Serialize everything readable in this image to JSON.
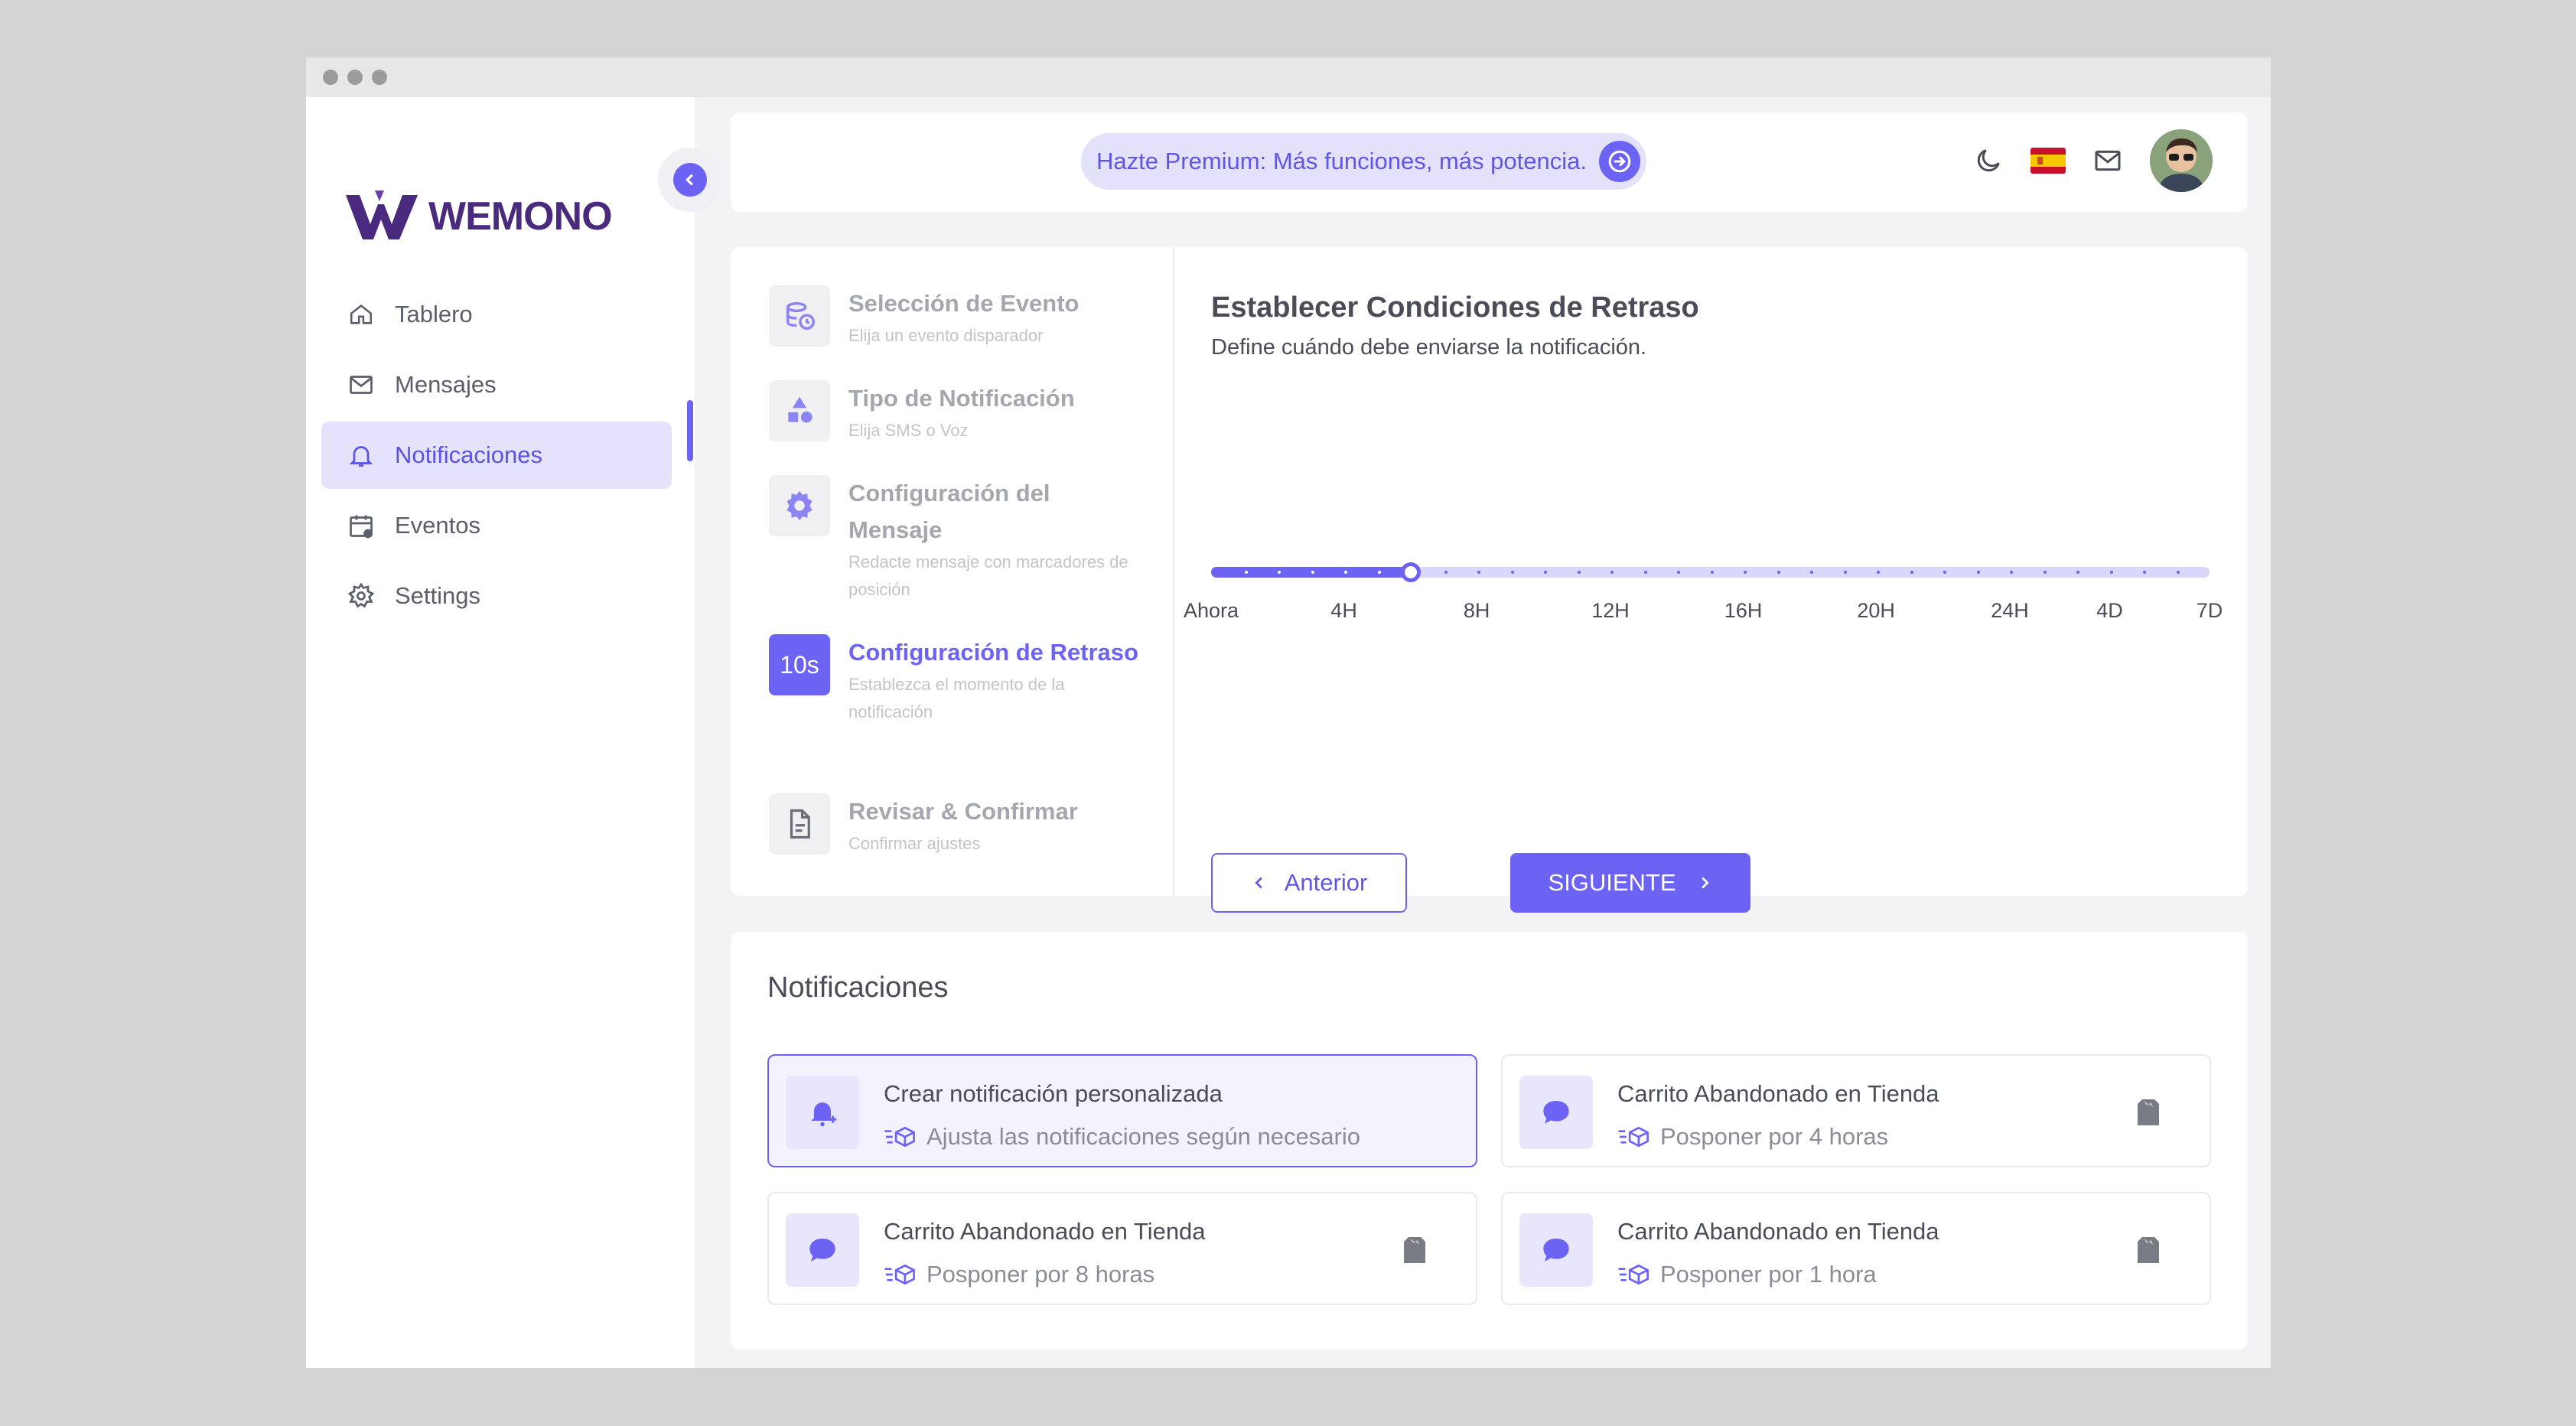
{
  "brand": {
    "name": "WEMONO",
    "accent": "#6c63f5",
    "logo_color": "#4a2a7e"
  },
  "sidebar": {
    "items": [
      {
        "label": "Tablero",
        "icon": "home-icon"
      },
      {
        "label": "Mensajes",
        "icon": "mail-icon"
      },
      {
        "label": "Notificaciones",
        "icon": "bell-icon",
        "active": true
      },
      {
        "label": "Eventos",
        "icon": "calendar-icon"
      },
      {
        "label": "Settings",
        "icon": "gear-icon"
      }
    ]
  },
  "topbar": {
    "premium_text": "Hazte Premium: Más funciones, más potencia.",
    "icons": [
      "moon-icon",
      "spain-flag-icon",
      "mail-icon",
      "avatar"
    ]
  },
  "wizard": {
    "steps": [
      {
        "title": "Selección de Evento",
        "subtitle": "Elija un evento disparador",
        "icon": "event-clock-icon"
      },
      {
        "title": "Tipo de Notificación",
        "subtitle": "Elija SMS o Voz",
        "icon": "shapes-icon"
      },
      {
        "title": "Configuración del Mensaje",
        "subtitle": "Redacte mensaje con marcadores de posición",
        "icon": "gear-icon"
      },
      {
        "title": "Configuración de Retraso",
        "subtitle": "Establezca el momento de la notificación",
        "icon_text": "10s",
        "active": true
      },
      {
        "title": "Revisar & Confirmar",
        "subtitle": "Confirmar ajustes",
        "icon": "document-icon"
      }
    ],
    "panel": {
      "title": "Establecer Condiciones de Retraso",
      "subtitle": "Define cuándo debe enviarse la notificación."
    },
    "slider": {
      "labels": [
        "Ahora",
        "4H",
        "8H",
        "12H",
        "16H",
        "20H",
        "24H",
        "4D",
        "7D"
      ],
      "value_fraction": 0.2
    },
    "prev_label": "Anterior",
    "next_label": "SIGUIENTE"
  },
  "notifications": {
    "heading": "Notificaciones",
    "cards": [
      {
        "title": "Crear notificación personalizada",
        "subtitle": "Ajusta las notificaciones según necesario",
        "icon": "bell-plus-icon",
        "custom": true
      },
      {
        "title": "Carrito Abandonado en Tienda",
        "subtitle": "Posponer por 4 horas",
        "icon": "chat-icon"
      },
      {
        "title": "Carrito Abandonado en Tienda",
        "subtitle": "Posponer por 8 horas",
        "icon": "chat-icon"
      },
      {
        "title": "Carrito Abandonado en Tienda",
        "subtitle": "Posponer por 1 hora",
        "icon": "chat-icon"
      }
    ]
  }
}
